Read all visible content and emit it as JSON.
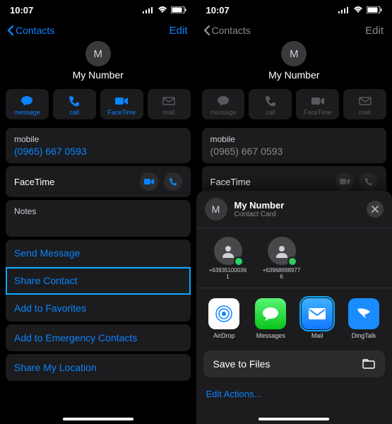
{
  "status": {
    "time": "10:07"
  },
  "left": {
    "nav": {
      "back": "Contacts",
      "edit": "Edit"
    },
    "avatar_initial": "M",
    "name": "My Number",
    "actions": {
      "message": "message",
      "call": "call",
      "facetime": "FaceTime",
      "mail": "mail"
    },
    "mobile": {
      "label": "mobile",
      "number": "(0965) 667 0593"
    },
    "facetime_label": "FaceTime",
    "notes_label": "Notes",
    "links": {
      "send_message": "Send Message",
      "share_contact": "Share Contact",
      "add_favorites": "Add to Favorites",
      "add_emergency": "Add to Emergency Contacts",
      "share_location": "Share My Location"
    }
  },
  "right": {
    "nav": {
      "back": "Contacts",
      "edit": "Edit"
    },
    "avatar_initial": "M",
    "name": "My Number",
    "actions": {
      "message": "message",
      "call": "call",
      "facetime": "FaceTime",
      "mail": "mail"
    },
    "mobile": {
      "label": "mobile",
      "number": "(0965) 667 0593"
    },
    "facetime_label": "FaceTime",
    "sheet": {
      "avatar_initial": "M",
      "title": "My Number",
      "subtitle": "Contact Card",
      "suggestions": [
        {
          "label": "+639351000361",
          "badge": "#25d366"
        },
        {
          "label": "+639686989776",
          "badge": "#34c759"
        }
      ],
      "apps": {
        "airdrop": "AirDrop",
        "messages": "Messages",
        "mail": "Mail",
        "dingtalk": "DingTalk"
      },
      "save": "Save to Files",
      "edit_actions": "Edit Actions..."
    }
  }
}
